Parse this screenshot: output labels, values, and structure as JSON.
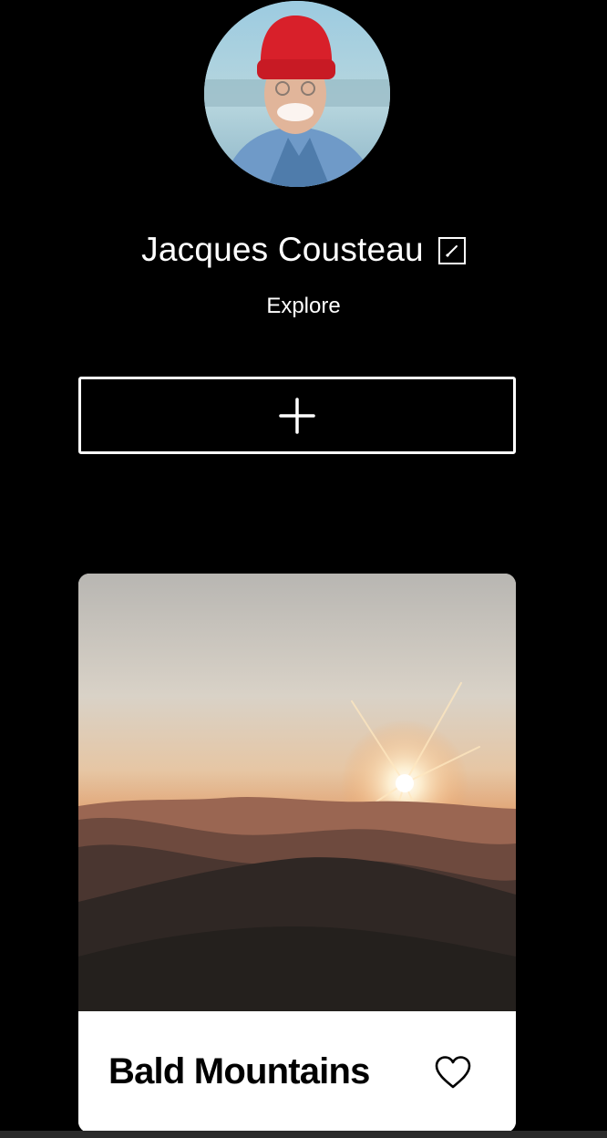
{
  "profile": {
    "name": "Jacques Cousteau",
    "subtitle": "Explore",
    "avatar_icon": "avatar-photo",
    "edit_icon": "pencil-square-icon"
  },
  "add_button": {
    "icon": "plus-icon"
  },
  "cards": [
    {
      "title": "Bald Mountains",
      "image_icon": "mountain-sunset-photo",
      "like_icon": "heart-outline-icon",
      "liked": false
    }
  ],
  "colors": {
    "background": "#000000",
    "text_primary": "#ffffff",
    "card_background": "#ffffff",
    "card_text": "#000000"
  }
}
